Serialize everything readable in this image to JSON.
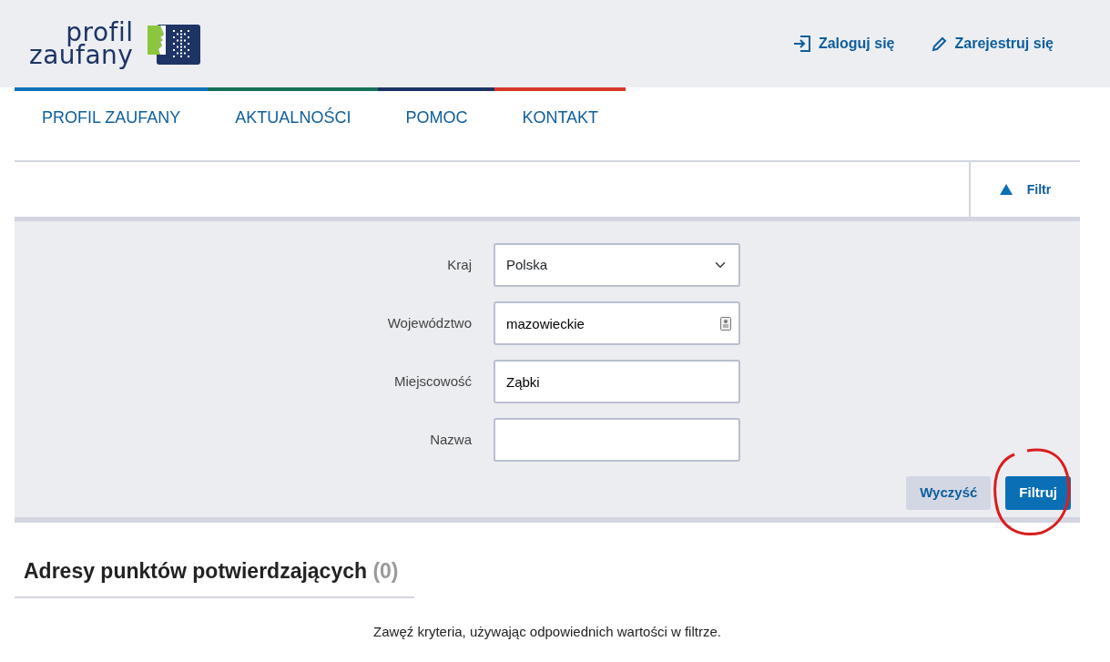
{
  "logo": {
    "line1": "profil",
    "line2": "zaufany"
  },
  "header_links": [
    {
      "kind": "login",
      "label": "Zaloguj się"
    },
    {
      "kind": "register",
      "label": "Zarejestruj się"
    }
  ],
  "nav": [
    {
      "label": "PROFIL ZAUFANY",
      "color": "#0a72b8"
    },
    {
      "label": "AKTUALNOŚCI",
      "color": "#17705a"
    },
    {
      "label": "POMOC",
      "color": "#1d3465"
    },
    {
      "label": "KONTAKT",
      "color": "#d9372b"
    }
  ],
  "filter_toggle": {
    "label": "Filtr",
    "expanded": true
  },
  "fields": [
    {
      "kind": "select",
      "label": "Kraj",
      "value": "Polska"
    },
    {
      "kind": "autofill",
      "label": "Województwo",
      "value": "mazowieckie"
    },
    {
      "kind": "text",
      "label": "Miejscowość",
      "value": "Ząbki"
    },
    {
      "kind": "text",
      "label": "Nazwa"
    }
  ],
  "buttons": [
    {
      "kind": "secondary",
      "label": "Wyczyść",
      "circled": false
    },
    {
      "kind": "primary",
      "label": "Filtruj",
      "circled": true
    }
  ],
  "results": {
    "title": "Adresy punktów potwierdzających",
    "count": "(0)",
    "message": "Zawęź kryteria, używając odpowiednich wartości w filtrze."
  }
}
